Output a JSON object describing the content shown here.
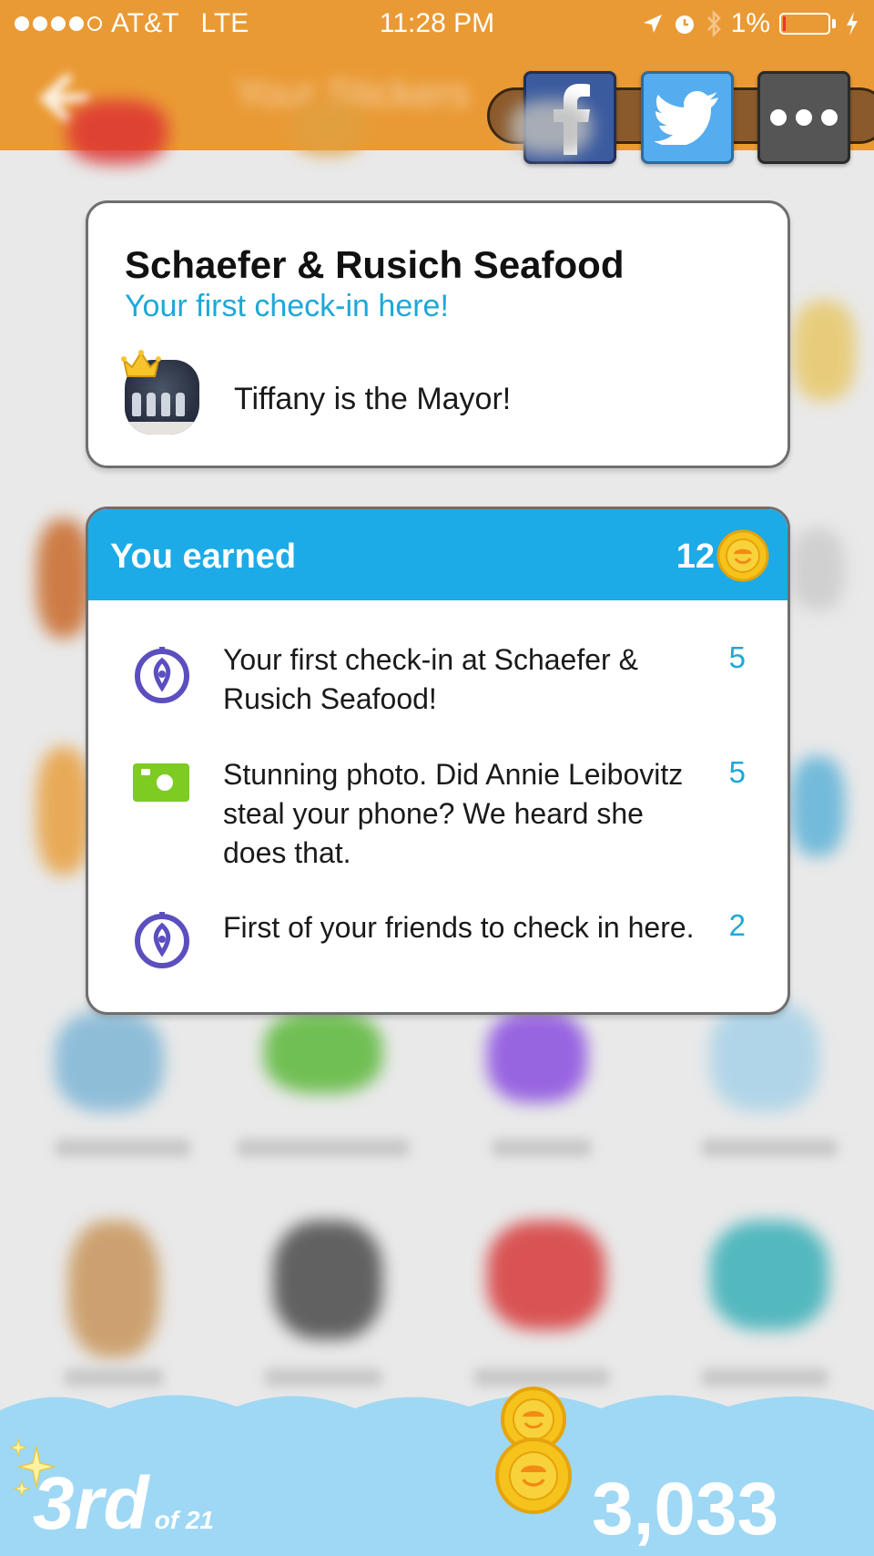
{
  "status_bar": {
    "carrier": "AT&T",
    "network": "LTE",
    "time": "11:28 PM",
    "battery": "1%"
  },
  "nav": {
    "title": "Your Stickers"
  },
  "share": {
    "facebook_icon": "facebook-icon",
    "twitter_icon": "twitter-icon",
    "more_icon": "more-icon"
  },
  "venue": {
    "name": "Schaefer & Rusich Seafood",
    "subtitle": "Your first check-in here!",
    "mayor_text": "Tiffany is the Mayor!"
  },
  "earned": {
    "title": "You earned",
    "total": "12",
    "items": [
      {
        "icon": "checkin-pin-icon",
        "text": "Your first check-in at Schaefer & Rusich Seafood!",
        "points": "5"
      },
      {
        "icon": "camera-icon",
        "text": "Stunning photo. Did Annie Leibovitz steal your phone? We heard she does that.",
        "points": "5"
      },
      {
        "icon": "checkin-pin-icon",
        "text": "First of your friends to check in here.",
        "points": "2"
      }
    ]
  },
  "leaderboard": {
    "rank": "3rd",
    "rank_of": "of 21",
    "coins": "3,033"
  },
  "colors": {
    "header_orange": "#ea9a35",
    "earned_blue": "#1cabe6",
    "link_blue": "#1ea8d7",
    "bottom_sky": "#9fd8f4",
    "coin_gold": "#f5c31b"
  }
}
